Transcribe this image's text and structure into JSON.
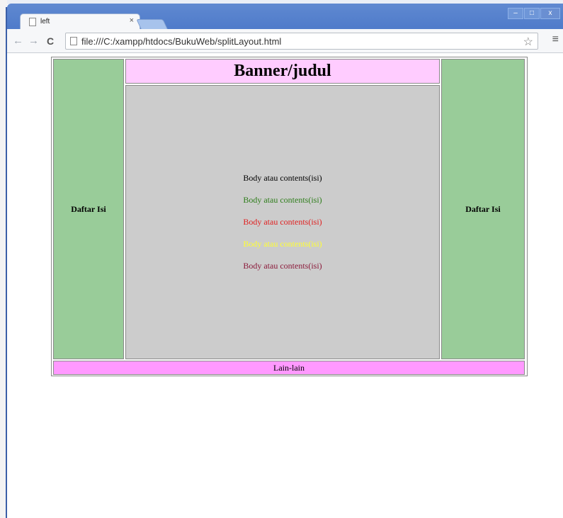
{
  "browser": {
    "tab_title": "left",
    "tab_close": "×",
    "url": "file:///C:/xampp/htdocs/BukuWeb/splitLayout.html",
    "window_buttons": [
      "–",
      "□",
      "x"
    ]
  },
  "page": {
    "banner": "Banner/judul",
    "left_nav": "Daftar Isi",
    "right_nav": "Daftar Isi",
    "body_lines": [
      {
        "text": "Body atau contents(isi)",
        "color": "#000000"
      },
      {
        "text": "Body atau contents(isi)",
        "color": "#2e7d1a"
      },
      {
        "text": "Body atau contents(isi)",
        "color": "#e02020"
      },
      {
        "text": "Body atau contents(isi)",
        "color": "#ffff33"
      },
      {
        "text": "Body atau contents(isi)",
        "color": "#8b1a3a"
      }
    ],
    "footer": "Lain-lain",
    "colors": {
      "side": "#99cc99",
      "banner": "#ffccff",
      "content": "#cccccc",
      "footer": "#ff99ff"
    }
  }
}
